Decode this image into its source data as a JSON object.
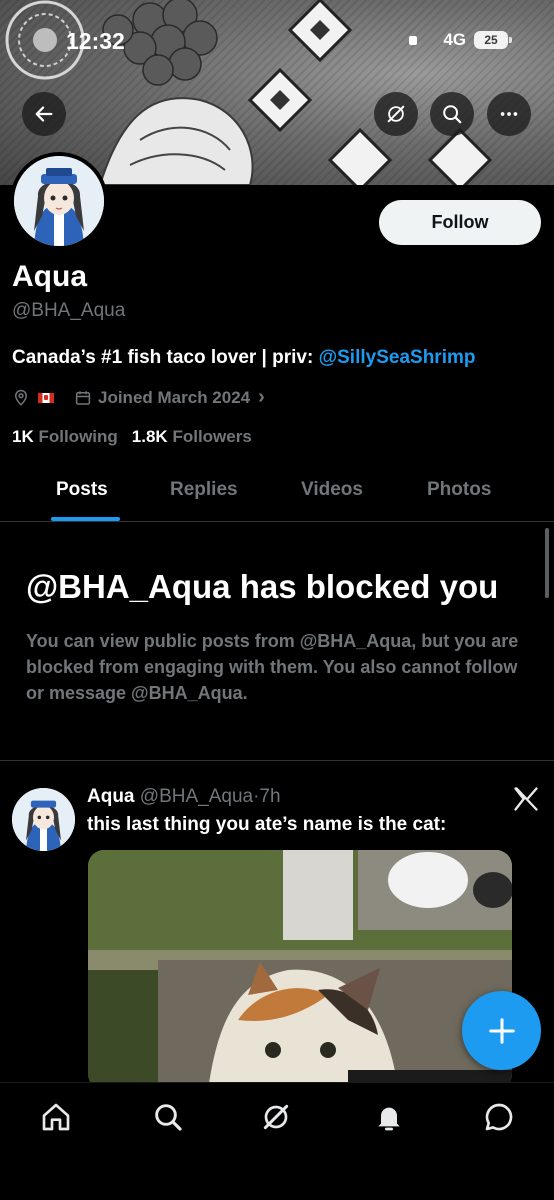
{
  "status_bar": {
    "time": "12:32",
    "network": "4G",
    "battery": "25"
  },
  "profile": {
    "display_name": "Aqua",
    "handle": "@BHA_Aqua",
    "follow_label": "Follow",
    "bio_text": "Canada’s #1 fish taco lover | priv: ",
    "bio_link": "@SillySeaShrimp",
    "joined": "Joined March 2024",
    "following_count": "1K",
    "following_label": "Following",
    "followers_count": "1.8K",
    "followers_label": "Followers"
  },
  "tabs": [
    "Posts",
    "Replies",
    "Videos",
    "Photos"
  ],
  "blocked": {
    "title": "@BHA_Aqua has blocked you",
    "message": "You can view public posts from @BHA_Aqua, but you are blocked from engaging with them. You also cannot follow or message @BHA_Aqua."
  },
  "post": {
    "author_name": "Aqua",
    "author_handle": "@BHA_Aqua",
    "separator": "·",
    "time": "7h",
    "text": "this last thing you ate’s name is the cat:"
  },
  "colors": {
    "accent": "#1d9bf0",
    "muted": "#71767b",
    "background": "#000000"
  },
  "icons": [
    "back-arrow-icon",
    "grok-icon",
    "search-icon",
    "more-icon",
    "location-icon",
    "calendar-icon",
    "x-logo-icon",
    "compose-plus-icon",
    "home-icon",
    "notifications-icon",
    "messages-icon"
  ]
}
